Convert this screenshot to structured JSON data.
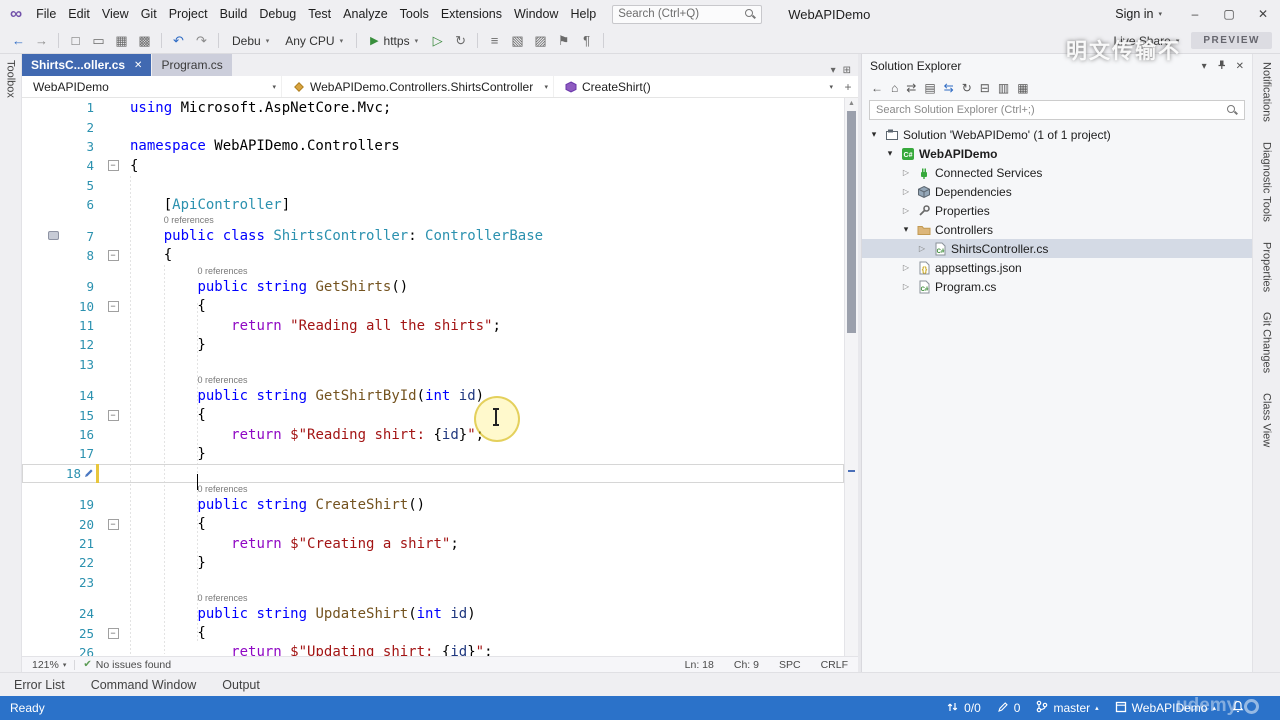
{
  "titlebar": {
    "menus": [
      "File",
      "Edit",
      "View",
      "Git",
      "Project",
      "Build",
      "Debug",
      "Test",
      "Analyze",
      "Tools",
      "Extensions",
      "Window",
      "Help"
    ],
    "search_placeholder": "Search (Ctrl+Q)",
    "app_title": "WebAPIDemo",
    "sign_in_label": "Sign in"
  },
  "toolbar": {
    "groups_left": [
      [
        "back-icon",
        "forward-icon"
      ],
      [
        "new-file-icon",
        "open-folder-icon",
        "save-icon",
        "save-all-icon"
      ],
      [
        "undo-icon",
        "redo-icon"
      ]
    ],
    "debug_config_label": "Debu",
    "platform_label": "Any CPU",
    "run_label": "https",
    "groups_right": [
      [
        "start-no-debug-icon",
        "refresh-icon"
      ],
      [
        "outline-icon",
        "comment-icon",
        "uncomment-icon",
        "bookmark-icon",
        "pilcrow-icon"
      ]
    ],
    "live_share_label": "Live Share",
    "preview_badge": "PREVIEW"
  },
  "doc_tabs": [
    {
      "label": "ShirtsC...oller.cs",
      "active": true
    },
    {
      "label": "Program.cs",
      "active": false
    }
  ],
  "breadcrumb": {
    "project": "WebAPIDemo",
    "type": "WebAPIDemo.Controllers.ShirtsController",
    "member": "CreateShirt()"
  },
  "editor": {
    "codelens_label": "0 references",
    "cursor": {
      "line": 18,
      "col": 9
    },
    "lines": [
      {
        "n": 1,
        "seg": [
          [
            "kw",
            "using"
          ],
          [
            "pln",
            " Microsoft.AspNetCore.Mvc;"
          ]
        ]
      },
      {
        "n": 2,
        "seg": []
      },
      {
        "n": 3,
        "seg": [
          [
            "kw",
            "namespace"
          ],
          [
            "pln",
            " WebAPIDemo.Controllers"
          ]
        ]
      },
      {
        "n": 4,
        "seg": [
          [
            "pln",
            "{"
          ]
        ],
        "fold": true
      },
      {
        "n": 5,
        "seg": []
      },
      {
        "n": 6,
        "seg": [
          [
            "pln",
            "    ["
          ],
          [
            "type",
            "ApiController"
          ],
          [
            "pln",
            "]"
          ]
        ]
      },
      {
        "n": 7,
        "lens": true,
        "lensIndent": 4,
        "glyph": "bookmark-margin-icon",
        "seg": [
          [
            "pln",
            "    "
          ],
          [
            "kw",
            "public"
          ],
          [
            "pln",
            " "
          ],
          [
            "kw",
            "class"
          ],
          [
            "pln",
            " "
          ],
          [
            "type",
            "ShirtsController"
          ],
          [
            "pln",
            ": "
          ],
          [
            "type",
            "ControllerBase"
          ]
        ]
      },
      {
        "n": 8,
        "seg": [
          [
            "pln",
            "    {"
          ]
        ],
        "fold": true
      },
      {
        "n": 9,
        "lens": true,
        "lensIndent": 8,
        "seg": [
          [
            "pln",
            "        "
          ],
          [
            "kw",
            "public"
          ],
          [
            "pln",
            " "
          ],
          [
            "kw",
            "string"
          ],
          [
            "pln",
            " "
          ],
          [
            "mth",
            "GetShirts"
          ],
          [
            "pln",
            "()"
          ]
        ]
      },
      {
        "n": 10,
        "seg": [
          [
            "pln",
            "        {"
          ]
        ],
        "fold": true
      },
      {
        "n": 11,
        "seg": [
          [
            "pln",
            "            "
          ],
          [
            "ctl",
            "return"
          ],
          [
            "pln",
            " "
          ],
          [
            "str",
            "\"Reading all the shirts\""
          ],
          [
            "pln",
            ";"
          ]
        ]
      },
      {
        "n": 12,
        "seg": [
          [
            "pln",
            "        }"
          ]
        ]
      },
      {
        "n": 13,
        "seg": []
      },
      {
        "n": 14,
        "lens": true,
        "lensIndent": 8,
        "seg": [
          [
            "pln",
            "        "
          ],
          [
            "kw",
            "public"
          ],
          [
            "pln",
            " "
          ],
          [
            "kw",
            "string"
          ],
          [
            "pln",
            " "
          ],
          [
            "mth",
            "GetShirtById"
          ],
          [
            "pln",
            "("
          ],
          [
            "kw",
            "int"
          ],
          [
            "pln",
            " "
          ],
          [
            "prm",
            "id"
          ],
          [
            "pln",
            ")"
          ]
        ]
      },
      {
        "n": 15,
        "seg": [
          [
            "pln",
            "        {"
          ]
        ],
        "fold": true
      },
      {
        "n": 16,
        "seg": [
          [
            "pln",
            "            "
          ],
          [
            "ctl",
            "return"
          ],
          [
            "pln",
            " "
          ],
          [
            "str",
            "$\"Reading shirt: "
          ],
          [
            "pln",
            "{"
          ],
          [
            "prm",
            "id"
          ],
          [
            "pln",
            "}"
          ],
          [
            "str",
            "\""
          ],
          [
            "pln",
            ";"
          ]
        ]
      },
      {
        "n": 17,
        "seg": [
          [
            "pln",
            "        }"
          ]
        ]
      },
      {
        "n": 18,
        "seg": [],
        "current": true,
        "modified": true
      },
      {
        "n": 19,
        "lens": true,
        "lensIndent": 8,
        "seg": [
          [
            "pln",
            "        "
          ],
          [
            "kw",
            "public"
          ],
          [
            "pln",
            " "
          ],
          [
            "kw",
            "string"
          ],
          [
            "pln",
            " "
          ],
          [
            "mth",
            "CreateShirt"
          ],
          [
            "pln",
            "()"
          ]
        ]
      },
      {
        "n": 20,
        "seg": [
          [
            "pln",
            "        {"
          ]
        ],
        "fold": true
      },
      {
        "n": 21,
        "seg": [
          [
            "pln",
            "            "
          ],
          [
            "ctl",
            "return"
          ],
          [
            "pln",
            " "
          ],
          [
            "str",
            "$\"Creating a shirt\""
          ],
          [
            "pln",
            ";"
          ]
        ]
      },
      {
        "n": 22,
        "seg": [
          [
            "pln",
            "        }"
          ]
        ]
      },
      {
        "n": 23,
        "seg": []
      },
      {
        "n": 24,
        "lens": true,
        "lensIndent": 8,
        "seg": [
          [
            "pln",
            "        "
          ],
          [
            "kw",
            "public"
          ],
          [
            "pln",
            " "
          ],
          [
            "kw",
            "string"
          ],
          [
            "pln",
            " "
          ],
          [
            "mth",
            "UpdateShirt"
          ],
          [
            "pln",
            "("
          ],
          [
            "kw",
            "int"
          ],
          [
            "pln",
            " "
          ],
          [
            "prm",
            "id"
          ],
          [
            "pln",
            ")"
          ]
        ]
      },
      {
        "n": 25,
        "seg": [
          [
            "pln",
            "        {"
          ]
        ],
        "fold": true
      },
      {
        "n": 26,
        "seg": [
          [
            "pln",
            "            "
          ],
          [
            "ctl",
            "return"
          ],
          [
            "pln",
            " "
          ],
          [
            "str",
            "$\"Updating shirt: "
          ],
          [
            "pln",
            "{"
          ],
          [
            "prm",
            "id"
          ],
          [
            "pln",
            "}"
          ],
          [
            "str",
            "\""
          ],
          [
            "pln",
            ";"
          ]
        ]
      }
    ],
    "status_left": {
      "zoom": "121%",
      "issues": "No issues found"
    },
    "status_right": {
      "line": "Ln: 18",
      "column": "Ch: 9",
      "space": "SPC",
      "eol": "CRLF"
    }
  },
  "solution_explorer": {
    "title": "Solution Explorer",
    "toolbar_icons": [
      "se-back-icon",
      "home-icon",
      "switch-views-icon",
      "pending-changes-icon",
      "sync-active-doc-icon",
      "se-refresh-icon",
      "collapse-all-icon",
      "show-all-files-icon",
      "se-properties-icon"
    ],
    "search_placeholder": "Search Solution Explorer (Ctrl+;)",
    "tree": [
      {
        "label": "Solution 'WebAPIDemo' (1 of 1 project)",
        "depth": 0,
        "icon": "solution-icon",
        "arrow": "expanded"
      },
      {
        "label": "WebAPIDemo",
        "depth": 1,
        "icon": "csharp-project-icon",
        "arrow": "expanded",
        "bold": true
      },
      {
        "label": "Connected Services",
        "depth": 2,
        "icon": "connected-services-icon",
        "arrow": "collapsed"
      },
      {
        "label": "Dependencies",
        "depth": 2,
        "icon": "dependencies-icon",
        "arrow": "collapsed"
      },
      {
        "label": "Properties",
        "depth": 2,
        "icon": "wrench-icon",
        "arrow": "collapsed"
      },
      {
        "label": "Controllers",
        "depth": 2,
        "icon": "folder-icon",
        "arrow": "expanded"
      },
      {
        "label": "ShirtsController.cs",
        "depth": 3,
        "icon": "csharp-file-icon",
        "arrow": "collapsed",
        "selected": true
      },
      {
        "label": "appsettings.json",
        "depth": 2,
        "icon": "json-file-icon",
        "arrow": "collapsed"
      },
      {
        "label": "Program.cs",
        "depth": 2,
        "icon": "csharp-file-icon",
        "arrow": "collapsed"
      }
    ]
  },
  "left_panel_tabs": [
    "Toolbox"
  ],
  "right_panel_tabs": [
    "Notifications",
    "Diagnostic Tools",
    "Properties",
    "Git Changes",
    "Class View"
  ],
  "bottom_panel_tabs": [
    "Error List",
    "Command Window",
    "Output"
  ],
  "statusbar": {
    "ready": "Ready",
    "sync_count": "0/0",
    "edit_count": "0",
    "branch": "master",
    "repo": "WebAPIDemo"
  },
  "watermarks": {
    "top": "明文传输不",
    "bottom": "udemy"
  },
  "colors": {
    "active_tab": "#4169B1",
    "statusbar": "#2B72C9",
    "keyword": "#0000FF",
    "control": "#8F08C4",
    "type": "#2B91AF",
    "method": "#74531F",
    "string": "#A31515",
    "parameter": "#1F377F",
    "line_number": "#2B91AF"
  }
}
